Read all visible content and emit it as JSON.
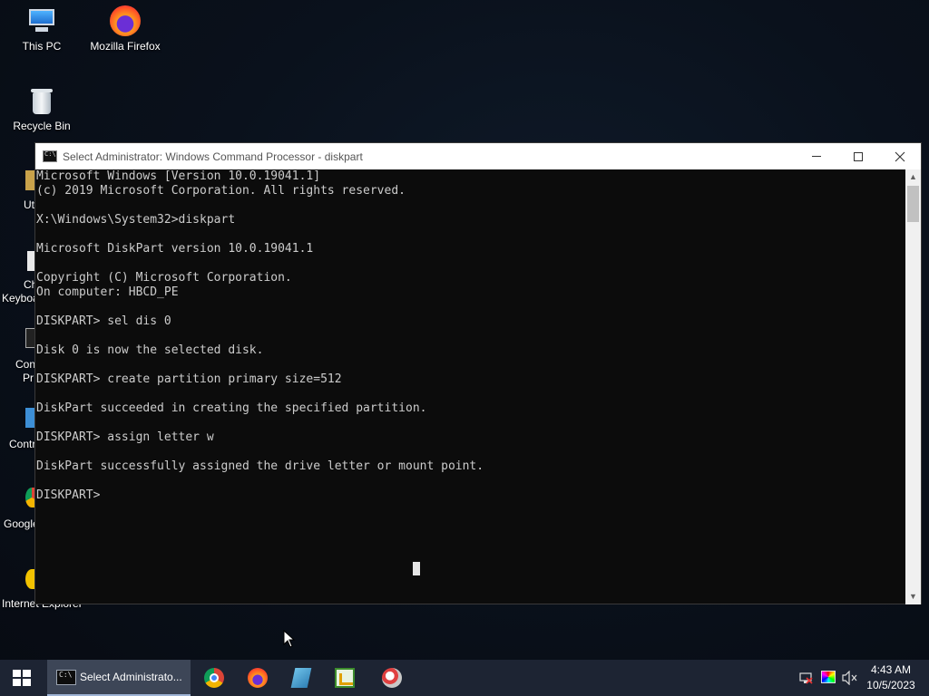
{
  "desktop": {
    "icons": [
      {
        "label": "This PC"
      },
      {
        "label": "Mozilla Firefox"
      },
      {
        "label": "Recycle Bin"
      }
    ],
    "partial_labels": [
      "Ut",
      "Ch",
      "Keyboa",
      "Con",
      "Pr",
      "Contr",
      "Google",
      "Internet Explorer"
    ]
  },
  "window": {
    "title": "Select Administrator: Windows Command Processor - diskpart",
    "console_lines": [
      "Microsoft Windows [Version 10.0.19041.1]",
      "(c) 2019 Microsoft Corporation. All rights reserved.",
      "",
      "X:\\Windows\\System32>diskpart",
      "",
      "Microsoft DiskPart version 10.0.19041.1",
      "",
      "Copyright (C) Microsoft Corporation.",
      "On computer: HBCD_PE",
      "",
      "DISKPART> sel dis 0",
      "",
      "Disk 0 is now the selected disk.",
      "",
      "DISKPART> create partition primary size=512",
      "",
      "DiskPart succeeded in creating the specified partition.",
      "",
      "DISKPART> assign letter w",
      "",
      "DiskPart successfully assigned the drive letter or mount point.",
      "",
      "DISKPART> "
    ]
  },
  "taskbar": {
    "active_task_label": "Select Administrato...",
    "pinned": [
      "chrome-icon",
      "firefox-icon",
      "notepad-icon",
      "spreadsheet-icon",
      "paint-icon"
    ],
    "clock": {
      "time": "4:43 AM",
      "date": "10/5/2023"
    }
  }
}
